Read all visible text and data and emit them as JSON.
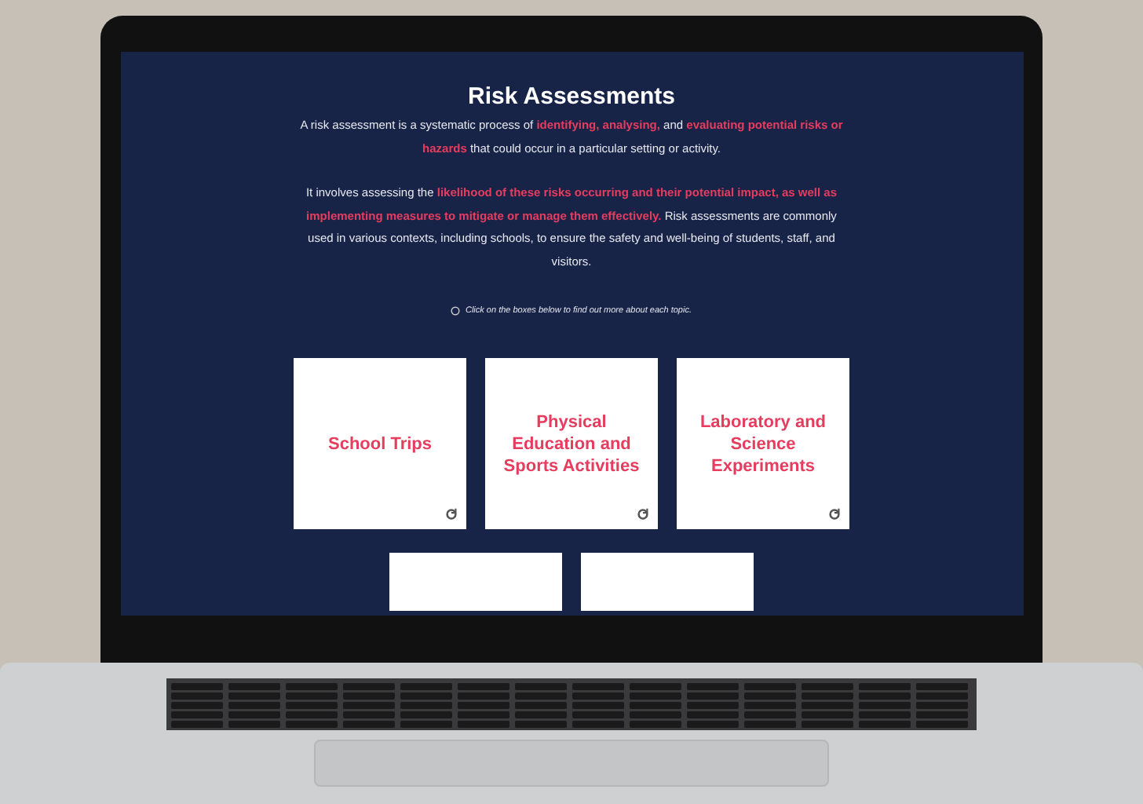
{
  "page": {
    "title": "Risk Assessments",
    "paragraphs": [
      "A risk assessment is a systematic process of **identifying, analysing,** and **evaluating potential risks or hazards** that could occur in a particular setting or activity.",
      "It involves assessing the **likelihood of these risks occurring and their potential impact, as well as implementing measures to mitigate or manage them effectively.** Risk assessments are commonly used in various contexts, including schools, to ensure the safety and well-being of students, staff, and visitors."
    ],
    "hint": "Click on the boxes below to find out more about each topic.",
    "cards": [
      {
        "kind": "full",
        "label": "School Trips"
      },
      {
        "kind": "full",
        "label": "Physical Education and Sports Activities"
      },
      {
        "kind": "full",
        "label": "Laboratory and Science Experiments"
      },
      {
        "kind": "cut"
      },
      {
        "kind": "cut"
      }
    ]
  }
}
